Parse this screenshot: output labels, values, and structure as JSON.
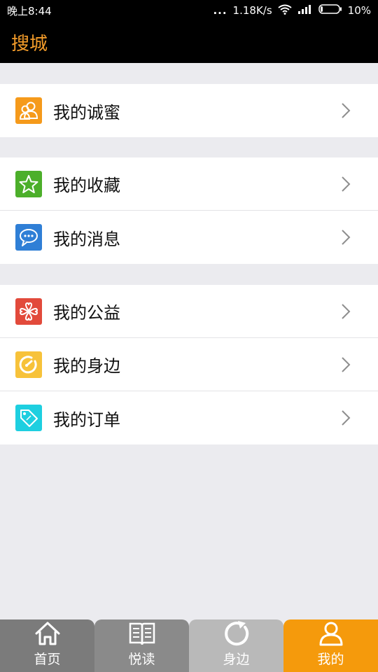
{
  "status": {
    "time": "晚上8:44",
    "dots": "...",
    "speed": "1.18K/s",
    "battery": "10%"
  },
  "header": {
    "title": "搜城"
  },
  "menu": [
    {
      "label": "我的诚蜜",
      "icon": "friends-icon",
      "color": "#f59a1b"
    },
    {
      "label": "我的收藏",
      "icon": "star-icon",
      "color": "#4caf2a"
    },
    {
      "label": "我的消息",
      "icon": "chat-bubble-icon",
      "color": "#2f7fd6"
    },
    {
      "label": "我的公益",
      "icon": "clover-icon",
      "color": "#e24a3b"
    },
    {
      "label": "我的身边",
      "icon": "nearby-icon",
      "color": "#f7c23a"
    },
    {
      "label": "我的订单",
      "icon": "sale-tag-icon",
      "color": "#1ecfe0"
    }
  ],
  "tabs": [
    {
      "label": "首页",
      "icon": "home-icon"
    },
    {
      "label": "悦读",
      "icon": "book-icon"
    },
    {
      "label": "身边",
      "icon": "refresh-icon"
    },
    {
      "label": "我的",
      "icon": "person-icon",
      "active": true
    }
  ]
}
